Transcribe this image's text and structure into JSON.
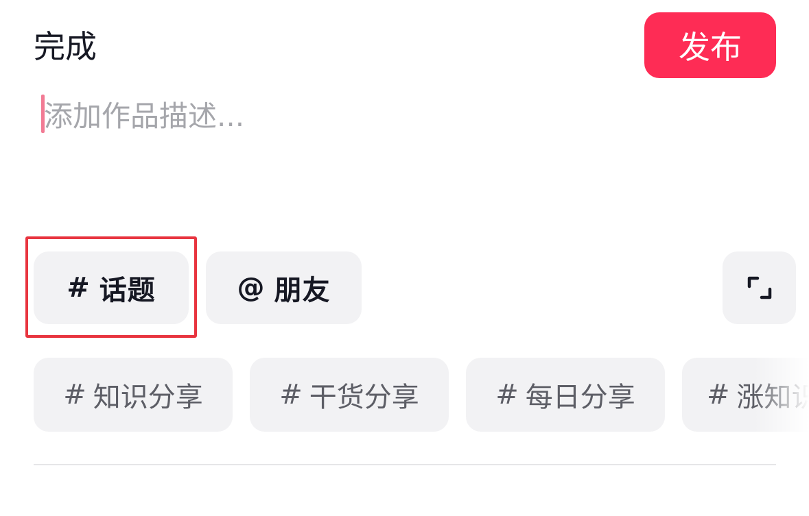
{
  "header": {
    "done_label": "完成",
    "publish_label": "发布"
  },
  "description": {
    "placeholder": "添加作品描述...",
    "value": ""
  },
  "actions": {
    "topic_symbol": "#",
    "topic_label": "话题",
    "friend_symbol": "@",
    "friend_label": "朋友",
    "expand_icon": "expand-corners-icon"
  },
  "suggestions": [
    {
      "symbol": "#",
      "label": "知识分享"
    },
    {
      "symbol": "#",
      "label": "干货分享"
    },
    {
      "symbol": "#",
      "label": "每日分享"
    },
    {
      "symbol": "#",
      "label": "涨知识"
    }
  ],
  "colors": {
    "accent": "#fe2c55",
    "highlight_border": "#e8343f",
    "chip_background": "#f2f2f4",
    "caret": "#f27b94"
  }
}
